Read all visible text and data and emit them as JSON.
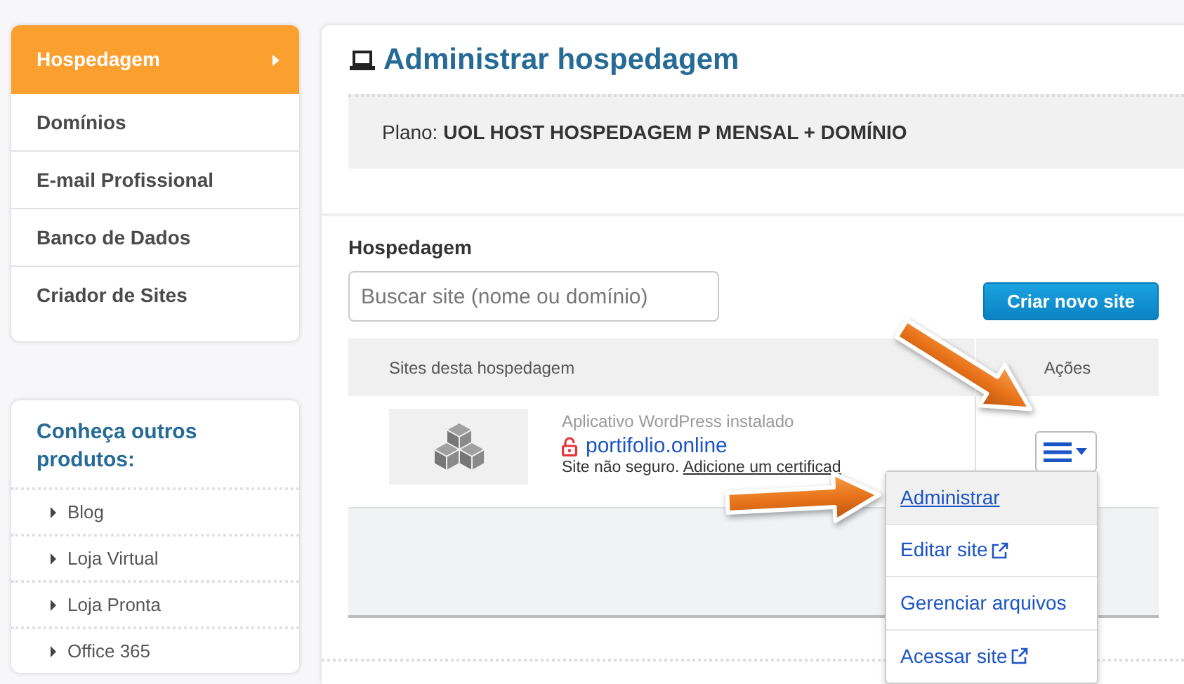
{
  "sidebar": {
    "menu": [
      {
        "label": "Hospedagem",
        "selected": true
      },
      {
        "label": "Domínios",
        "selected": false
      },
      {
        "label": "E-mail Profissional",
        "selected": false
      },
      {
        "label": "Banco de Dados",
        "selected": false
      },
      {
        "label": "Criador de Sites",
        "selected": false
      }
    ],
    "products": {
      "title": "Conheça outros produtos:",
      "items": [
        "Blog",
        "Loja Virtual",
        "Loja Pronta",
        "Office 365"
      ]
    }
  },
  "main": {
    "title": "Administrar hospedagem",
    "plan": {
      "label": "Plano:",
      "value": "UOL HOST HOSPEDAGEM P MENSAL + DOMÍNIO"
    },
    "section_label": "Hospedagem",
    "search": {
      "placeholder": "Buscar site (nome ou domínio)"
    },
    "create_button": "Criar novo site",
    "table": {
      "columns": [
        "Sites desta hospedagem",
        "Ações"
      ],
      "rows": [
        {
          "app": "Aplicativo WordPress instalado",
          "domain": "portifolio.online",
          "secure": false,
          "warning": "Site não seguro.",
          "warning_link": "Adicione um certificad"
        }
      ]
    },
    "actions_menu": {
      "expanded": true,
      "items": [
        {
          "label": "Administrar",
          "selected": true,
          "external": false
        },
        {
          "label": "Editar site",
          "selected": false,
          "external": true
        },
        {
          "label": "Gerenciar arquivos",
          "selected": false,
          "external": false
        },
        {
          "label": "Acessar site",
          "selected": false,
          "external": true
        }
      ]
    }
  },
  "annotations": [
    {
      "kind": "diagonal"
    },
    {
      "kind": "horizontal"
    }
  ]
}
